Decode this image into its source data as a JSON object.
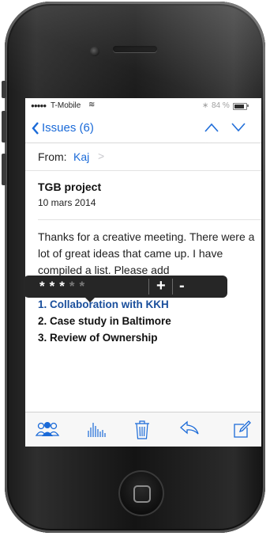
{
  "status_bar": {
    "signal": "●●●●●",
    "carrier": "T-Mobile",
    "wifi_glyph": "≋",
    "bt_glyph": "∗",
    "battery": "84 %",
    "battery_level": 0.84
  },
  "nav": {
    "back_label": "Issues (6)",
    "accent": "#1a6ad8"
  },
  "message": {
    "from_label": "From:",
    "from_name": "Kaj",
    "subject": "TGB project",
    "date": "10 mars 2014",
    "body": "Thanks for a creative meeting. There were a lot of great ideas that came up. I have compiled a list. Please add",
    "list": [
      "1. Collaboration with KKH",
      "2. Case study in Baltimore",
      "3. Review of Ownership"
    ]
  },
  "rating_popup": {
    "stars": [
      "*",
      "*",
      "*",
      "*",
      "*"
    ],
    "filled": 3,
    "plus": "+",
    "minus": "-"
  },
  "toolbar": {
    "icons": [
      "contacts-icon",
      "stats-icon",
      "trash-icon",
      "reply-icon",
      "compose-icon"
    ]
  }
}
